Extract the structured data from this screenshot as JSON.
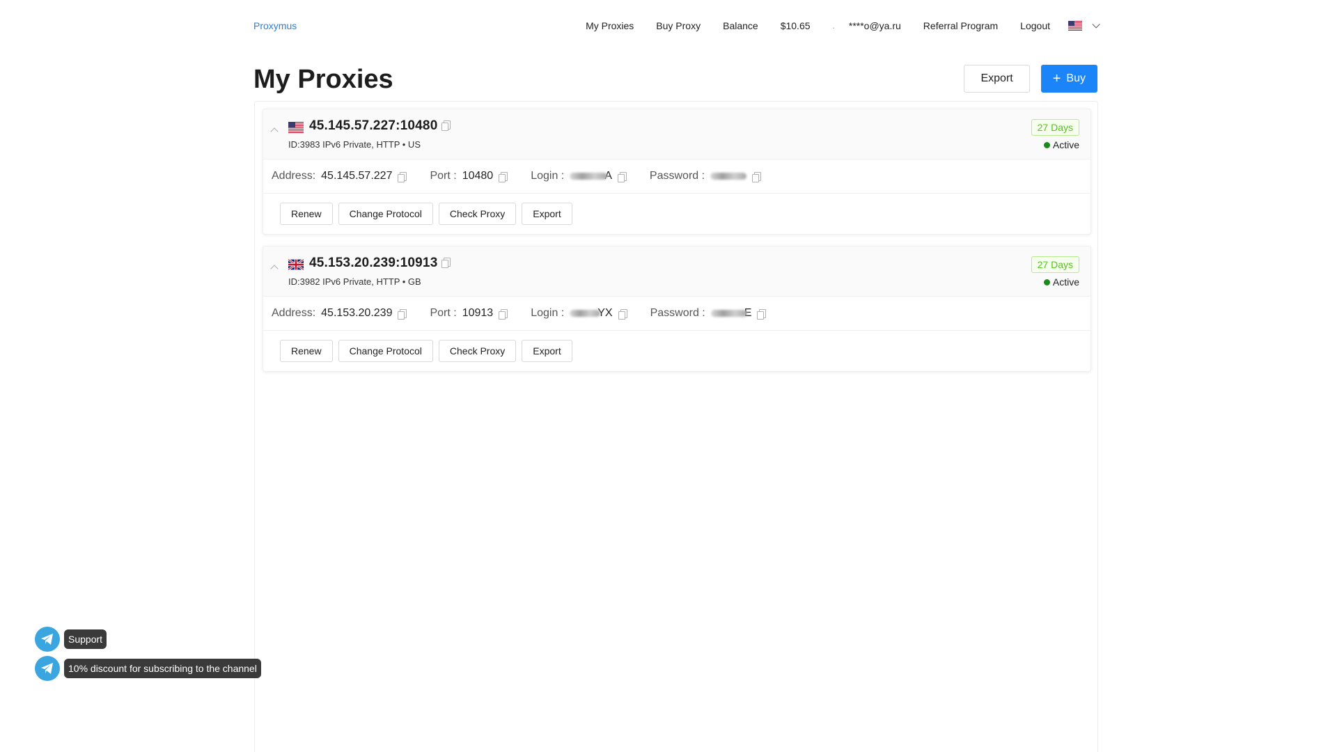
{
  "header": {
    "logo": "Proxymus",
    "nav": {
      "my_proxies": "My Proxies",
      "buy_proxy": "Buy Proxy",
      "balance_label": "Balance",
      "balance_value": "$10.65",
      "separator": ".",
      "email": "****o@ya.ru",
      "referral": "Referral Program",
      "logout": "Logout"
    },
    "language_flag": "us-flag-icon"
  },
  "page": {
    "title": "My Proxies",
    "export_label": "Export",
    "buy_label": "Buy",
    "buy_icon": "plus-icon"
  },
  "labels": {
    "address": "Address:",
    "port": "Port :",
    "login": "Login :",
    "password": "Password :",
    "renew": "Renew",
    "change_protocol": "Change Protocol",
    "check_proxy": "Check Proxy",
    "export": "Export"
  },
  "proxies": [
    {
      "flag": "us-flag-icon",
      "endpoint": "45.145.57.227:10480",
      "meta": "ID:3983 IPv6 Private, HTTP  • US",
      "days": "27 Days",
      "status": "Active",
      "status_color": "#1a8a1a",
      "address": "45.145.57.227",
      "port": "10480",
      "login_tail": "A",
      "password_tail": "",
      "login_masked": "blurred",
      "password_masked": "blurred"
    },
    {
      "flag": "gb-flag-icon",
      "endpoint": "45.153.20.239:10913",
      "meta": "ID:3982 IPv6 Private, HTTP  • GB",
      "days": "27 Days",
      "status": "Active",
      "status_color": "#1a8a1a",
      "address": "45.153.20.239",
      "port": "10913",
      "login_tail": "YX",
      "password_tail": "E",
      "login_masked": "blurred",
      "password_masked": "blurred"
    }
  ],
  "widgets": {
    "support_label": "Support",
    "channel_label": "10% discount for subscribing to the channel",
    "icon": "telegram-icon"
  },
  "colors": {
    "accent": "#1a84f8",
    "logo": "#2b7fd4",
    "days_tag": "#52c41a",
    "telegram": "#3ba5e0"
  }
}
